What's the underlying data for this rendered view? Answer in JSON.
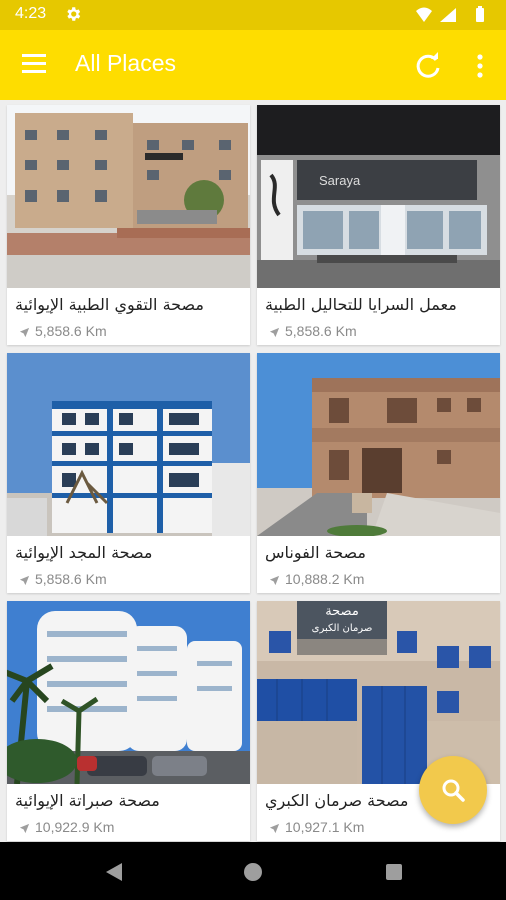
{
  "status_bar": {
    "time": "4:23"
  },
  "app_bar": {
    "title": "All Places"
  },
  "places": [
    {
      "name": "مصحة التقوي الطبية الإيوائية",
      "distance": "5,858.6 Km"
    },
    {
      "name": "معمل السرايا للتحاليل الطبية",
      "distance": "5,858.6 Km"
    },
    {
      "name": "مصحة المجد الإيوائية",
      "distance": "5,858.6 Km"
    },
    {
      "name": "مصحة الفوناس",
      "distance": "10,888.2 Km"
    },
    {
      "name": "مصحة صبراتة الإيوائية",
      "distance": "10,922.9 Km"
    },
    {
      "name": "مصحة صرمان الكبري",
      "distance": "10,927.1 Km"
    }
  ],
  "photo_text": {
    "saraya_sign": "Saraya",
    "sorman_sign_line1": "مصحة",
    "sorman_sign_line2": "صرمان الكبرى"
  },
  "colors": {
    "app_bar": "#fedd00",
    "status_bar": "#e6c800",
    "fab": "#f2c94c",
    "nav_bar": "#000000"
  },
  "icons": {
    "menu": "menu-icon",
    "refresh": "refresh-icon",
    "more": "more-vert-icon",
    "search": "search-icon",
    "distance": "navigation-arrow-icon"
  }
}
